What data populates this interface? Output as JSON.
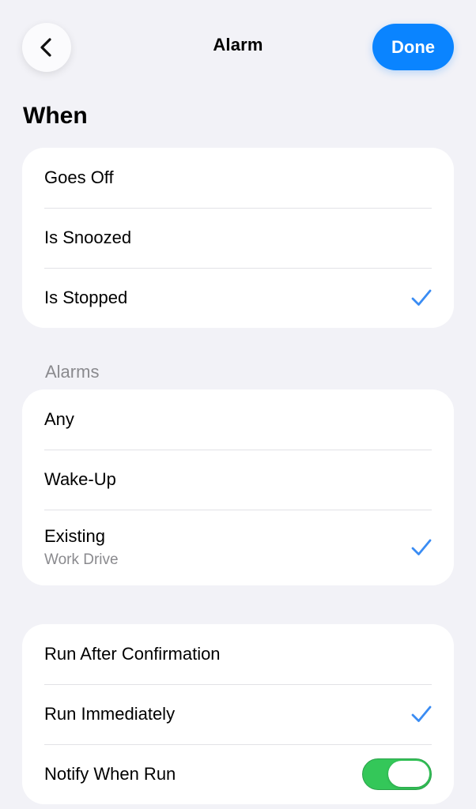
{
  "header": {
    "title": "Alarm",
    "done_label": "Done"
  },
  "when": {
    "heading": "When",
    "items": [
      {
        "label": "Goes Off",
        "checked": false
      },
      {
        "label": "Is Snoozed",
        "checked": false
      },
      {
        "label": "Is Stopped",
        "checked": true
      }
    ]
  },
  "alarms": {
    "label": "Alarms",
    "items": [
      {
        "label": "Any",
        "checked": false
      },
      {
        "label": "Wake-Up",
        "checked": false
      },
      {
        "label": "Existing",
        "sublabel": "Work Drive",
        "checked": true
      }
    ]
  },
  "run": {
    "items": [
      {
        "label": "Run After Confirmation",
        "checked": false
      },
      {
        "label": "Run Immediately",
        "checked": true
      },
      {
        "label": "Notify When Run",
        "toggle_on": true
      }
    ]
  },
  "colors": {
    "accent": "#0a84ff",
    "toggle_on": "#34c759",
    "background": "#f2f2f7",
    "checkmark": "#3a8cf3"
  },
  "icons": {
    "back": "chevron-left-icon",
    "check": "checkmark-icon"
  }
}
